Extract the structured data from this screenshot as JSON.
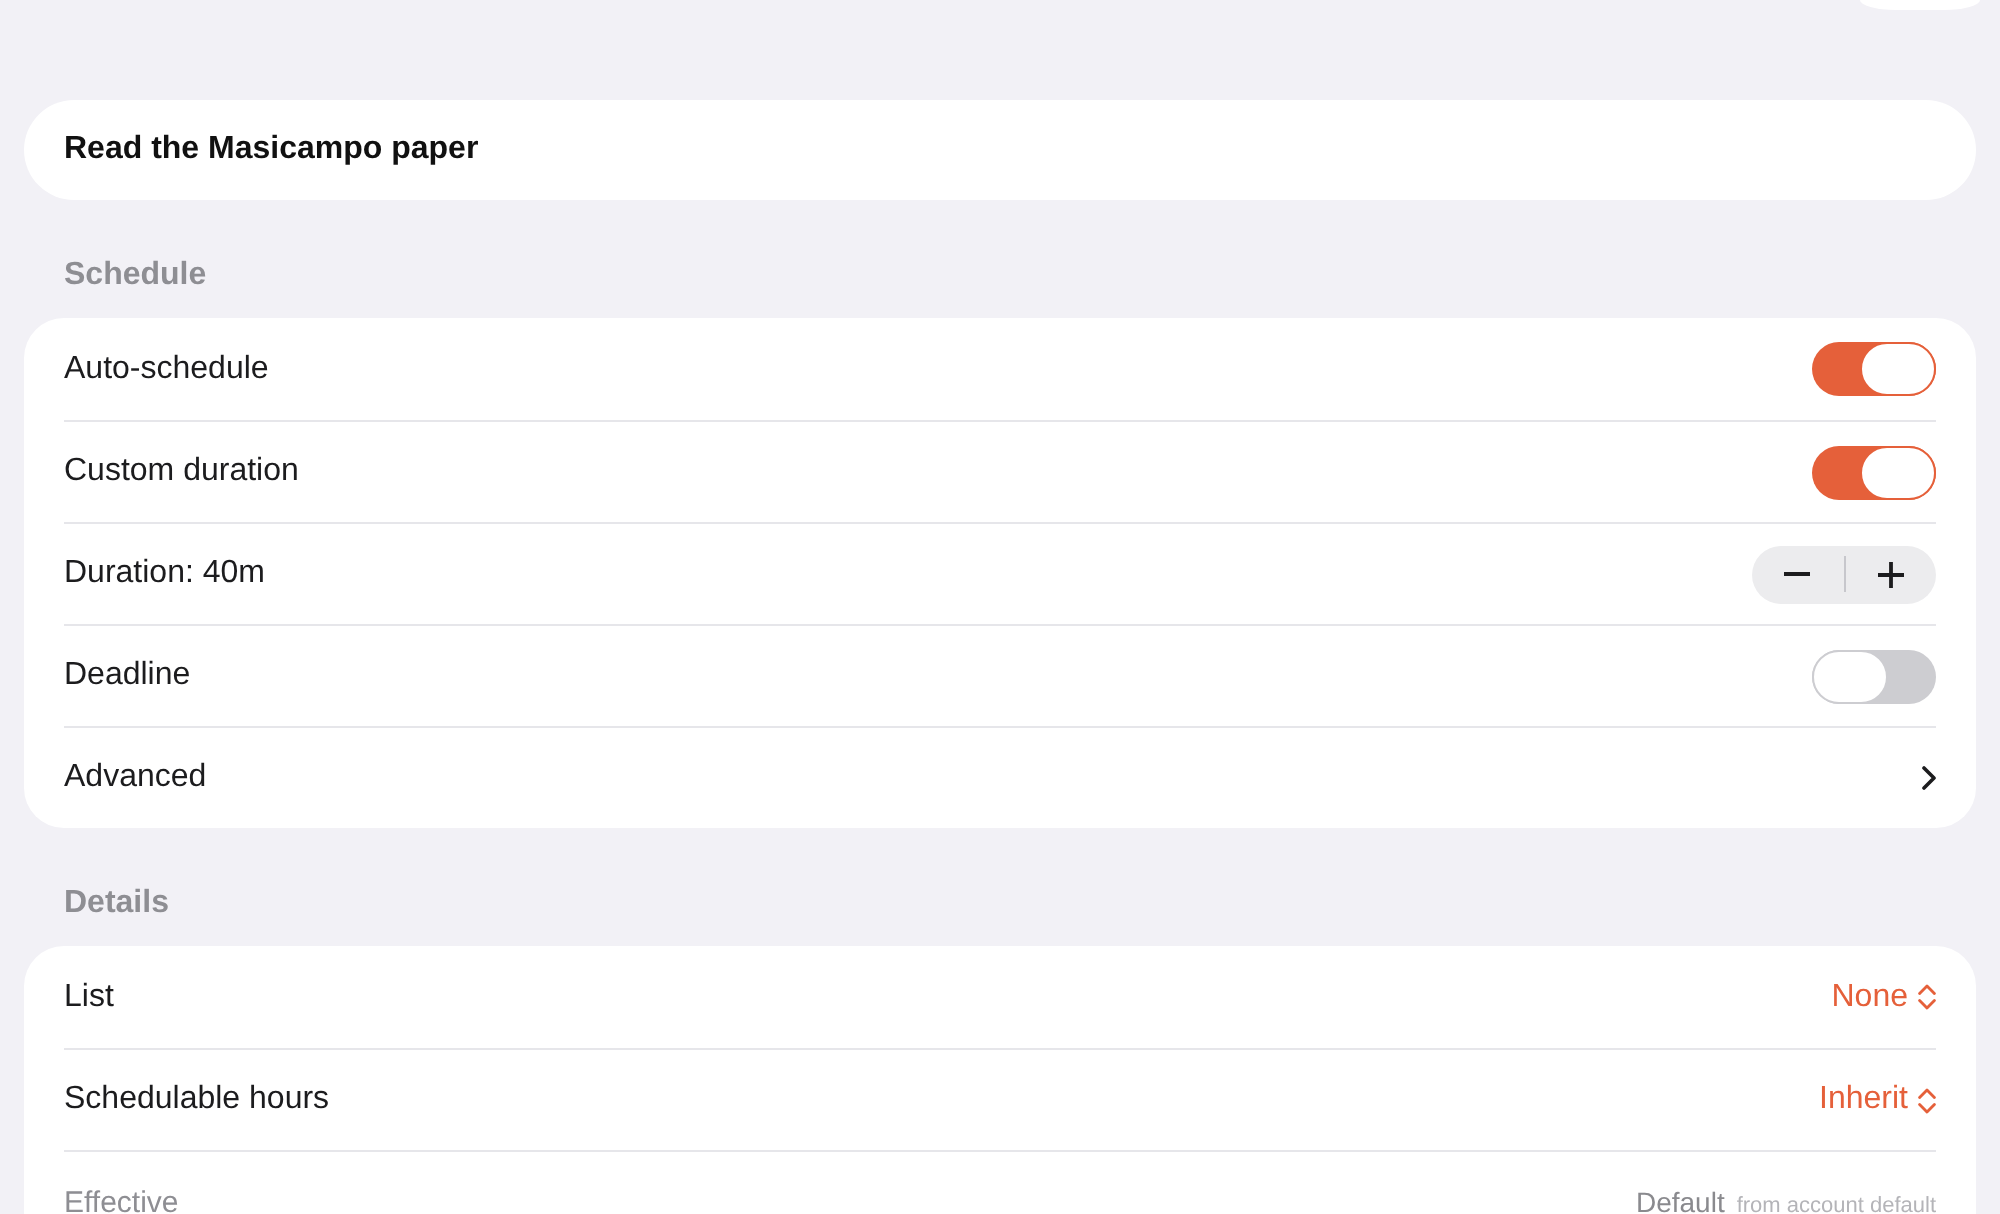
{
  "task": {
    "title": "Read the Masicampo paper"
  },
  "sections": [
    {
      "header": "Schedule",
      "rows": [
        {
          "kind": "toggle",
          "label": "Auto-schedule",
          "on": true
        },
        {
          "kind": "toggle",
          "label": "Custom duration",
          "on": true
        },
        {
          "kind": "stepper",
          "label": "Duration: 40m"
        },
        {
          "kind": "toggle",
          "label": "Deadline",
          "on": false
        },
        {
          "kind": "link",
          "label": "Advanced"
        }
      ]
    },
    {
      "header": "Details",
      "rows": [
        {
          "kind": "picker",
          "label": "List",
          "value": "None"
        },
        {
          "kind": "picker",
          "label": "Schedulable hours",
          "value": "Inherit"
        },
        {
          "kind": "info",
          "label": "Effective",
          "value": "Default",
          "note": "from account default"
        }
      ]
    }
  ]
}
